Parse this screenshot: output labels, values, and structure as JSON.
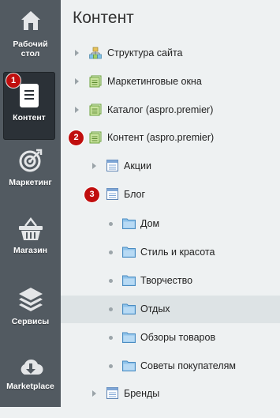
{
  "sidebar": {
    "items": [
      {
        "label_lines": [
          "Рабочий",
          "стол"
        ],
        "icon": "home-icon"
      },
      {
        "label_lines": [
          "Контент"
        ],
        "icon": "document-icon",
        "active": true,
        "badge": "1"
      },
      {
        "label_lines": [
          "Маркетинг"
        ],
        "icon": "target-icon"
      },
      {
        "label_lines": [
          "Магазин"
        ],
        "icon": "basket-icon"
      },
      {
        "label_lines": [
          "Сервисы"
        ],
        "icon": "layers-icon"
      },
      {
        "label_lines": [
          "Marketplace"
        ],
        "icon": "cloud-download-icon"
      }
    ]
  },
  "main": {
    "title": "Контент",
    "tree": [
      {
        "label": "Структура сайта",
        "level": 0,
        "expander": "arrow",
        "icon": "site-structure-icon"
      },
      {
        "label": "Маркетинговые окна",
        "level": 0,
        "expander": "arrow",
        "icon": "iblock-type-icon"
      },
      {
        "label": "Каталог (aspro.premier)",
        "level": 0,
        "expander": "arrow",
        "icon": "iblock-type-icon"
      },
      {
        "label": "Контент (aspro.premier)",
        "level": 0,
        "expander": "badge",
        "badge": "2",
        "icon": "iblock-type-icon"
      },
      {
        "label": "Акции",
        "level": 1,
        "expander": "arrow",
        "icon": "iblock-icon"
      },
      {
        "label": "Блог",
        "level": 1,
        "expander": "badge",
        "badge": "3",
        "icon": "iblock-icon"
      },
      {
        "label": "Дом",
        "level": 2,
        "expander": "dot",
        "icon": "folder-icon"
      },
      {
        "label": "Стиль и красота",
        "level": 2,
        "expander": "dot",
        "icon": "folder-icon"
      },
      {
        "label": "Творчество",
        "level": 2,
        "expander": "dot",
        "icon": "folder-icon"
      },
      {
        "label": "Отдых",
        "level": 2,
        "expander": "dot",
        "icon": "folder-icon",
        "selected": true
      },
      {
        "label": "Обзоры товаров",
        "level": 2,
        "expander": "dot",
        "icon": "folder-icon"
      },
      {
        "label": "Советы покупателям",
        "level": 2,
        "expander": "dot",
        "icon": "folder-icon"
      },
      {
        "label": "Бренды",
        "level": 1,
        "expander": "arrow",
        "icon": "iblock-icon"
      }
    ]
  },
  "colors": {
    "sidebar_bg": "#525a61",
    "sidebar_active_bg": "#2b3137",
    "badge_red": "#c00e0e",
    "panel_bg": "#eef1f2",
    "selected_row_bg": "#dde3e5",
    "folder_blue": "#8fc3ea"
  }
}
